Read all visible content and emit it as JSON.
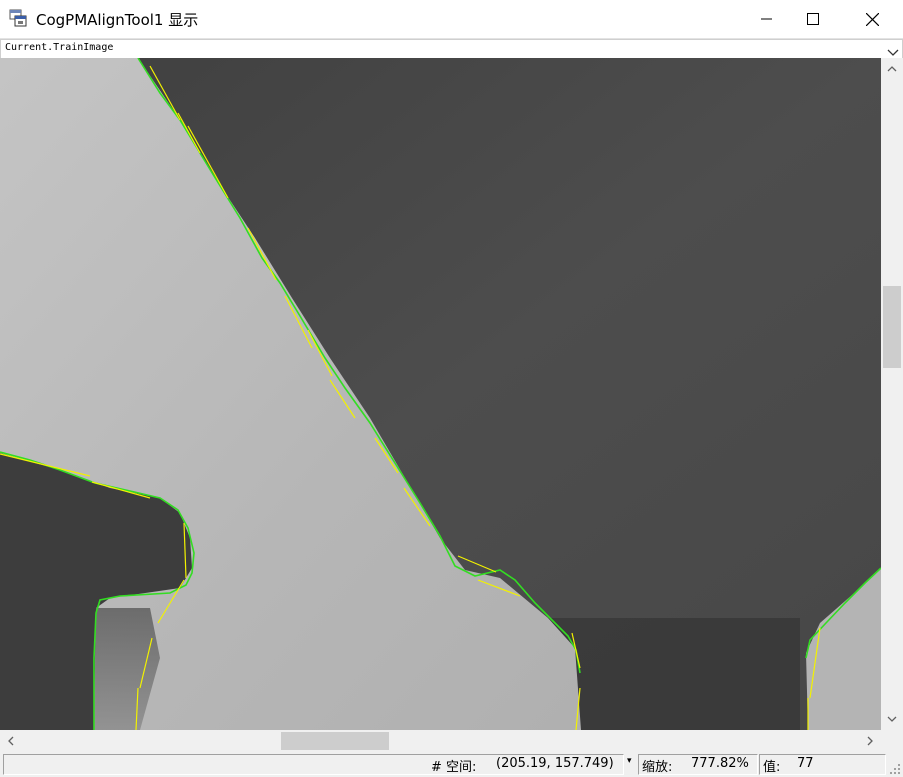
{
  "window": {
    "title": "CogPMAlignTool1 显示"
  },
  "image_selector": {
    "value": "Current.TrainImage"
  },
  "status": {
    "coord_label": "# 空间:",
    "coord_value": "(205.19, 157.749)",
    "zoom_label": "缩放:",
    "zoom_value": "777.82%",
    "pixel_label": "值:",
    "pixel_value": "77"
  },
  "colors": {
    "edge_green": "#33dd22",
    "edge_yellow": "#f2f200",
    "bright_region": "#b9b9b9",
    "dark_region": "#4b4b4b"
  },
  "icons": {
    "app": "app-window-icon",
    "minimize": "minimize-icon",
    "maximize": "maximize-icon",
    "close": "close-icon",
    "dropdown": "chevron-down-icon"
  }
}
